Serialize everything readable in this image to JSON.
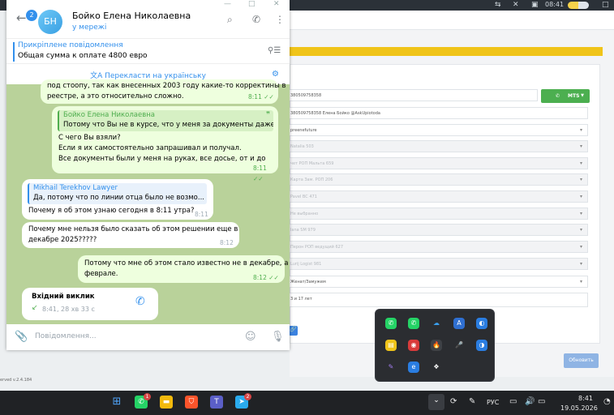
{
  "telegram": {
    "unread_badge": "2",
    "avatar_initials": "БН",
    "contact_name": "Бойко Елена Николаевна",
    "status": "у мережі",
    "pinned": {
      "title": "Прикріплене повідомлення",
      "text": "Общая сумма к оплате 4800 евро"
    },
    "translate_label": "Перекласти на українську",
    "messages": {
      "m1": {
        "line1": "под стоопу, так как внесенных 2003 году какие-то корректины в",
        "line2": "реестре, а это относительно сложно.",
        "time": "8:11"
      },
      "m2": {
        "quote_name": "Бойко Елена Николаевна",
        "quote_text": "Потому что Вы не в курсе, что у меня за документы даже....",
        "line1": "С чего Вы взяли?",
        "line2": "Если я их самостоятельно запрашивал и получал.",
        "line3": "Все документы были у меня на руках, все досье, от и до",
        "time": "8:11"
      },
      "m3": {
        "quote_name": "Mikhail Terekhov Lawyer",
        "quote_text": "Да, потому что по линии отца было не возмо...",
        "line1": "Почему я об этом узнаю сегодня в 8:11 утра?",
        "time": "8:11"
      },
      "m4": {
        "line1": "Почему мне нельзя было сказать об этом решении еще в",
        "line2": "декабре 2025?????",
        "time": "8:12"
      },
      "m5": {
        "line1": "Потому что мне об этом стало известно не в декабре, а",
        "line2": "феврале.",
        "time": "8:12"
      },
      "call": {
        "title": "Вхідний виклик",
        "info": "8:41, 28 хв 33 с"
      }
    },
    "composer_placeholder": "Повідомлення..."
  },
  "crm": {
    "phone_value": "380509758358",
    "mts_label": "MTS",
    "fields": [
      "380509758358 Елена Бойко @AskUpiotoda",
      "preenefuture",
      "Natalia 503",
      "чет РОП Мальта 659",
      "Карта Зам. РОП 206",
      "Pavel ВС 471",
      "Не выбранно",
      "lana SM 979",
      "Перон РОП ведущий 627",
      "Lurij Logist 981",
      "Женат/Замужем",
      "3 и 17 лет"
    ],
    "update_button": "Обновить",
    "version": "erved v.2.4.184"
  },
  "topbar": {
    "time": "08:41"
  },
  "taskbar": {
    "whatsapp_badge": "1",
    "telegram_badge": "2",
    "language": "РУС",
    "time": "8:41",
    "date": "19.05.2026"
  }
}
